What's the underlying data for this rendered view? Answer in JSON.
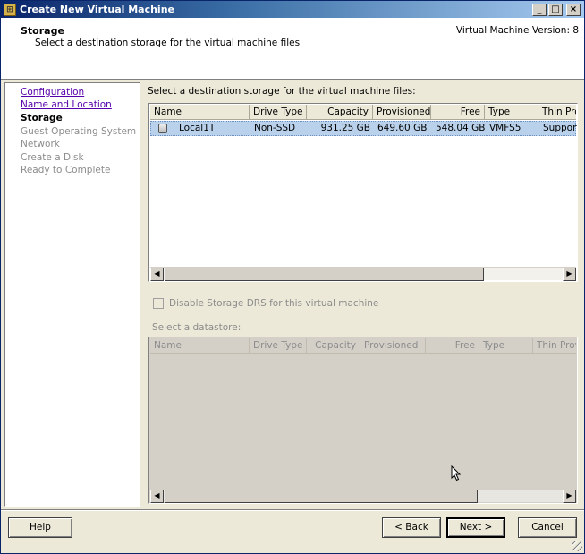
{
  "window": {
    "title": "Create New Virtual Machine",
    "controls": {
      "minimize": "_",
      "maximize": "□",
      "close": "×"
    }
  },
  "header": {
    "title": "Storage",
    "subtitle": "Select a destination storage for the virtual machine files",
    "version": "Virtual Machine Version: 8"
  },
  "nav": {
    "items": [
      {
        "label": "Configuration",
        "state": "link"
      },
      {
        "label": "Name and Location",
        "state": "link"
      },
      {
        "label": "Storage",
        "state": "current"
      },
      {
        "label": "Guest Operating System",
        "state": "disabled"
      },
      {
        "label": "Network",
        "state": "disabled"
      },
      {
        "label": "Create a Disk",
        "state": "disabled"
      },
      {
        "label": "Ready to Complete",
        "state": "disabled"
      }
    ]
  },
  "main": {
    "label": "Select a destination storage for the virtual machine files:",
    "columns": [
      "Name",
      "Drive Type",
      "Capacity",
      "Provisioned",
      "Free",
      "Type",
      "Thin Prov"
    ],
    "rows": [
      {
        "name": "Local1T",
        "drive_type": "Non-SSD",
        "capacity": "931.25 GB",
        "provisioned": "649.60 GB",
        "free": "548.04 GB",
        "type": "VMFS5",
        "thin": "Supporte"
      }
    ],
    "drs_checkbox_label": "Disable Storage DRS for this virtual machine",
    "select_datastore_label": "Select a datastore:",
    "bottom_columns": [
      "Name",
      "Drive Type",
      "Capacity",
      "Provisioned",
      "Free",
      "Type",
      "Thin Provi"
    ]
  },
  "footer": {
    "help": "Help",
    "back": "< Back",
    "next": "Next >",
    "cancel": "Cancel"
  },
  "colors": {
    "title_bar": "#0a246a",
    "selection": "#b9d1ea",
    "link": "#5500aa"
  }
}
